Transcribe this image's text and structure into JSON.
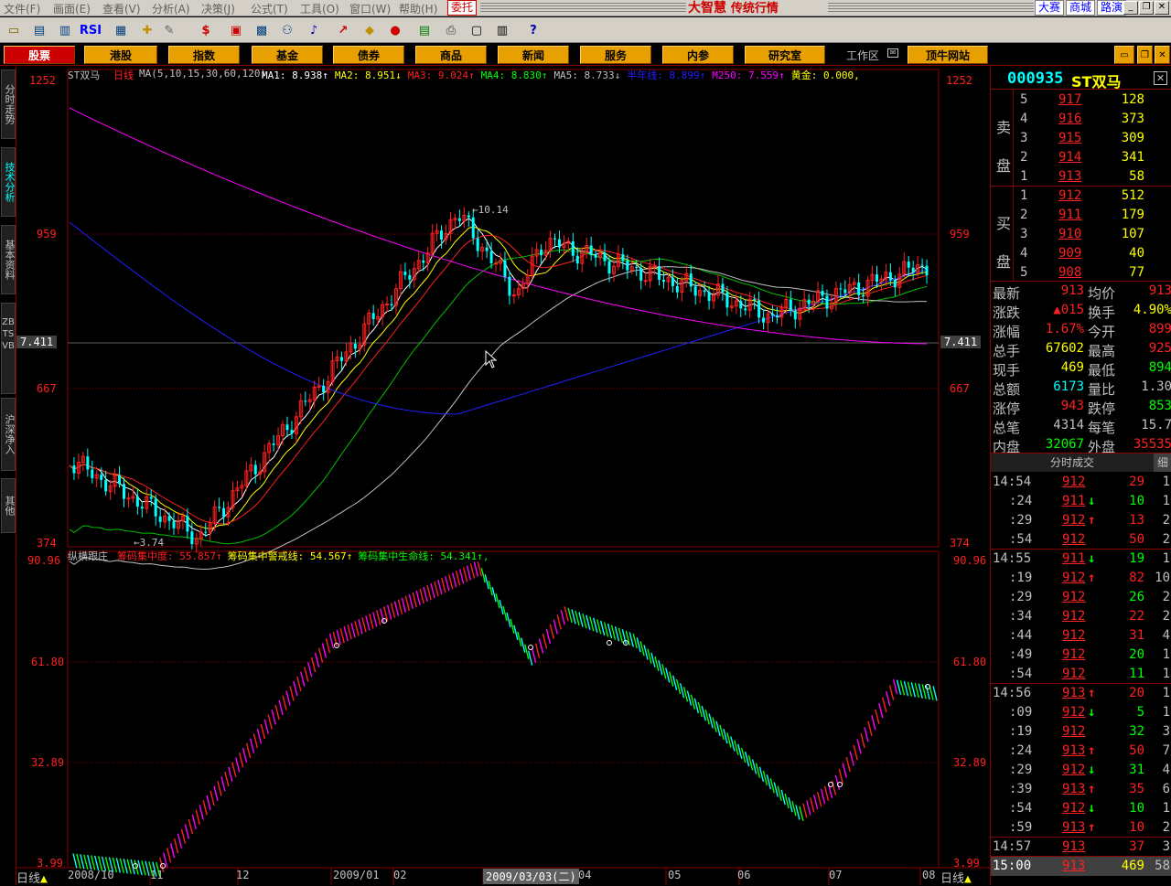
{
  "menu": {
    "items": [
      "文件(F)",
      "画面(E)",
      "查看(V)",
      "分析(A)",
      "决策(J)",
      "公式(T)",
      "工具(O)",
      "窗口(W)",
      "帮助(H)"
    ],
    "weituo": "委托",
    "app_title": "大智慧",
    "app_subtitle": "传统行情",
    "right_buttons": [
      "大赛",
      "商城",
      "路演"
    ]
  },
  "toolbar": {
    "rsi_label": "RSI"
  },
  "nav": {
    "buttons": [
      "股票",
      "港股",
      "指数",
      "基金",
      "债券",
      "商品",
      "新闻",
      "服务",
      "内参",
      "研究室"
    ],
    "workspace": "工作区",
    "site": "顶牛网站"
  },
  "sidetabs": [
    "分时走势",
    "技术分析",
    "基本资料",
    "ZBTSVB",
    "沪深净入",
    "其他"
  ],
  "chart": {
    "symbol_name": "ST双马",
    "period": "日线",
    "ma_params": "MA(5,10,15,30,60,120)",
    "ma_items": [
      {
        "label": "MA1: 8.938",
        "arrow": "↑",
        "color": "#ffffff"
      },
      {
        "label": "MA2: 8.951",
        "arrow": "↓",
        "color": "#ffff00"
      },
      {
        "label": "MA3: 9.024",
        "arrow": "↑",
        "color": "#ff2020"
      },
      {
        "label": "MA4: 8.830",
        "arrow": "↑",
        "color": "#00ff00"
      },
      {
        "label": "MA5: 8.733",
        "arrow": "↓",
        "color": "#c0c0c0"
      },
      {
        "label": "半年线: 8.899",
        "arrow": "↑",
        "color": "#2020ff"
      },
      {
        "label": "M250: 7.559",
        "arrow": "↑",
        "color": "#ff00ff"
      },
      {
        "label": "黄金: 0.000,",
        "arrow": "",
        "color": "#ffff00"
      }
    ],
    "price_axis": [
      "1252",
      "959",
      "7.411",
      "667",
      "374"
    ],
    "high_label": "10.14",
    "low_label": "3.74",
    "indicator_name": "纵横跟庄",
    "ind_items": [
      {
        "label": "筹码集中度: 55.857",
        "arrow": "↑",
        "color": "#ff2020"
      },
      {
        "label": "筹码集中警戒线: 54.567",
        "arrow": "↑",
        "color": "#ffff00"
      },
      {
        "label": "筹码集中生命线: 54.341",
        "arrow": "↑,",
        "color": "#00ff00"
      }
    ],
    "ind_axis": [
      "90.96",
      "61.80",
      "32.89",
      "3.99"
    ],
    "date_labels": [
      "2008/10",
      "11",
      "12",
      "2009/01",
      "02",
      "",
      "04",
      "05",
      "06",
      "07",
      "08"
    ],
    "cursor_date": "2009/03/03(二)",
    "period_tab": "日线"
  },
  "quote": {
    "code": "000935",
    "name": "ST双马",
    "sell_label": [
      "卖",
      "盘"
    ],
    "buy_label": [
      "买",
      "盘"
    ],
    "sell": [
      {
        "lvl": "5",
        "price": "917",
        "vol": "128"
      },
      {
        "lvl": "4",
        "price": "916",
        "vol": "373"
      },
      {
        "lvl": "3",
        "price": "915",
        "vol": "309"
      },
      {
        "lvl": "2",
        "price": "914",
        "vol": "341"
      },
      {
        "lvl": "1",
        "price": "913",
        "vol": "58"
      }
    ],
    "buy": [
      {
        "lvl": "1",
        "price": "912",
        "vol": "512"
      },
      {
        "lvl": "2",
        "price": "911",
        "vol": "179"
      },
      {
        "lvl": "3",
        "price": "910",
        "vol": "107"
      },
      {
        "lvl": "4",
        "price": "909",
        "vol": "40"
      },
      {
        "lvl": "5",
        "price": "908",
        "vol": "77"
      }
    ],
    "stats": [
      {
        "l1": "最新",
        "v1": "913",
        "c1": "#ff2020",
        "l2": "均价",
        "v2": "913",
        "c2": "#ff2020"
      },
      {
        "l1": "涨跌",
        "v1": "▲015",
        "c1": "#ff2020",
        "l2": "换手",
        "v2": "4.90%",
        "c2": "#ffff00"
      },
      {
        "l1": "涨幅",
        "v1": "1.67%",
        "c1": "#ff2020",
        "l2": "今开",
        "v2": "899",
        "c2": "#ff2020"
      },
      {
        "l1": "总手",
        "v1": "67602",
        "c1": "#ffff00",
        "l2": "最高",
        "v2": "925",
        "c2": "#ff2020"
      },
      {
        "l1": "现手",
        "v1": "469",
        "c1": "#ffff00",
        "l2": "最低",
        "v2": "894",
        "c2": "#00ff00"
      },
      {
        "l1": "总额",
        "v1": "6173",
        "c1": "#00ffff",
        "l2": "量比",
        "v2": "1.30",
        "c2": "#c0c0c0"
      },
      {
        "l1": "涨停",
        "v1": "943",
        "c1": "#ff2020",
        "l2": "跌停",
        "v2": "853",
        "c2": "#00ff00"
      },
      {
        "l1": "总笔",
        "v1": "4314",
        "c1": "#c0c0c0",
        "l2": "每笔",
        "v2": "15.7",
        "c2": "#c0c0c0"
      },
      {
        "l1": "内盘",
        "v1": "32067",
        "c1": "#00ff00",
        "l2": "外盘",
        "v2": "35535",
        "c2": "#ff2020"
      }
    ],
    "ticks_header": "分时成交",
    "ticks_tab": "细",
    "ticks": [
      {
        "t": "14:54",
        "p": "912",
        "a": "",
        "v": "29",
        "n": "1",
        "vc": "#ff2020"
      },
      {
        "t": ":24",
        "p": "911",
        "a": "↓",
        "v": "10",
        "n": "1",
        "vc": "#00ff00"
      },
      {
        "t": ":29",
        "p": "912",
        "a": "↑",
        "v": "13",
        "n": "2",
        "vc": "#ff2020"
      },
      {
        "t": ":54",
        "p": "912",
        "a": "",
        "v": "50",
        "n": "2",
        "vc": "#ff2020"
      },
      {
        "t": "14:55",
        "p": "911",
        "a": "↓",
        "v": "19",
        "n": "1",
        "vc": "#00ff00"
      },
      {
        "t": ":19",
        "p": "912",
        "a": "↑",
        "v": "82",
        "n": "10",
        "vc": "#ff2020"
      },
      {
        "t": ":29",
        "p": "912",
        "a": "",
        "v": "26",
        "n": "2",
        "vc": "#00ff00"
      },
      {
        "t": ":34",
        "p": "912",
        "a": "",
        "v": "22",
        "n": "2",
        "vc": "#ff2020"
      },
      {
        "t": ":44",
        "p": "912",
        "a": "",
        "v": "31",
        "n": "4",
        "vc": "#ff2020"
      },
      {
        "t": ":49",
        "p": "912",
        "a": "",
        "v": "20",
        "n": "1",
        "vc": "#00ff00"
      },
      {
        "t": ":54",
        "p": "912",
        "a": "",
        "v": "11",
        "n": "1",
        "vc": "#00ff00"
      },
      {
        "t": "14:56",
        "p": "913",
        "a": "↑",
        "v": "20",
        "n": "1",
        "vc": "#ff2020"
      },
      {
        "t": ":09",
        "p": "912",
        "a": "↓",
        "v": "5",
        "n": "1",
        "vc": "#00ff00"
      },
      {
        "t": ":19",
        "p": "912",
        "a": "",
        "v": "32",
        "n": "3",
        "vc": "#00ff00"
      },
      {
        "t": ":24",
        "p": "913",
        "a": "↑",
        "v": "50",
        "n": "7",
        "vc": "#ff2020"
      },
      {
        "t": ":29",
        "p": "912",
        "a": "↓",
        "v": "31",
        "n": "4",
        "vc": "#00ff00"
      },
      {
        "t": ":39",
        "p": "913",
        "a": "↑",
        "v": "35",
        "n": "6",
        "vc": "#ff2020"
      },
      {
        "t": ":54",
        "p": "912",
        "a": "↓",
        "v": "10",
        "n": "1",
        "vc": "#00ff00"
      },
      {
        "t": ":59",
        "p": "913",
        "a": "↑",
        "v": "10",
        "n": "2",
        "vc": "#ff2020"
      },
      {
        "t": "14:57",
        "p": "913",
        "a": "",
        "v": "37",
        "n": "3",
        "vc": "#ff2020"
      },
      {
        "t": "15:00",
        "p": "913",
        "a": "",
        "v": "469",
        "n": "58",
        "vc": "#ffff00"
      }
    ]
  },
  "colors": {
    "up": "#ff2020",
    "down": "#00ffff",
    "grid": "#800000",
    "ma250": "#ff00ff",
    "ma120": "#2020ff"
  }
}
